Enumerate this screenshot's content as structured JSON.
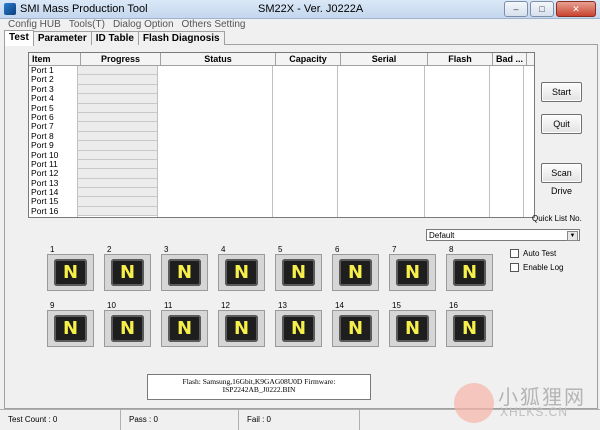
{
  "window": {
    "title": "SMI Mass Production Tool",
    "version": "SM22X - Ver. J0222A",
    "controls": [
      "–",
      "□",
      "✕"
    ]
  },
  "menu": [
    "Config HUB",
    "Tools(T)",
    "Dialog Option",
    "Others Setting"
  ],
  "tabs": [
    "Test",
    "Parameter",
    "ID Table",
    "Flash Diagnosis"
  ],
  "grid": {
    "headers": [
      "Item",
      "Progress",
      "Status",
      "Capacity",
      "Serial",
      "Flash",
      "Bad ..."
    ],
    "ports": [
      "Port 1",
      "Port 2",
      "Port 3",
      "Port 4",
      "Port 5",
      "Port 6",
      "Port 7",
      "Port 8",
      "Port 9",
      "Port 10",
      "Port 11",
      "Port 12",
      "Port 13",
      "Port 14",
      "Port 15",
      "Port 16"
    ]
  },
  "buttons": {
    "start": "Start",
    "quit": "Quit",
    "scan": "Scan Drive"
  },
  "quick_list": {
    "label": "Quick List No.",
    "selected": "Default"
  },
  "options": {
    "auto_test": "Auto Test",
    "enable_log": "Enable Log"
  },
  "drives": [
    {
      "num": "1",
      "letter": "N"
    },
    {
      "num": "2",
      "letter": "N"
    },
    {
      "num": "3",
      "letter": "N"
    },
    {
      "num": "4",
      "letter": "N"
    },
    {
      "num": "5",
      "letter": "N"
    },
    {
      "num": "6",
      "letter": "N"
    },
    {
      "num": "7",
      "letter": "N"
    },
    {
      "num": "8",
      "letter": "N"
    },
    {
      "num": "9",
      "letter": "N"
    },
    {
      "num": "10",
      "letter": "N"
    },
    {
      "num": "11",
      "letter": "N"
    },
    {
      "num": "12",
      "letter": "N"
    },
    {
      "num": "13",
      "letter": "N"
    },
    {
      "num": "14",
      "letter": "N"
    },
    {
      "num": "15",
      "letter": "N"
    },
    {
      "num": "16",
      "letter": "N"
    }
  ],
  "info": {
    "line1": "Flash: Samsung,16Gbit,K9GAG08U0D     Firmware:",
    "line2": "ISP2242AB_J0222.BIN"
  },
  "status": {
    "test_count": "Test Count : 0",
    "pass": "Pass : 0",
    "fail": "Fail : 0"
  },
  "watermark": {
    "cn": "小狐狸网",
    "en": "XHLKS.CN"
  }
}
